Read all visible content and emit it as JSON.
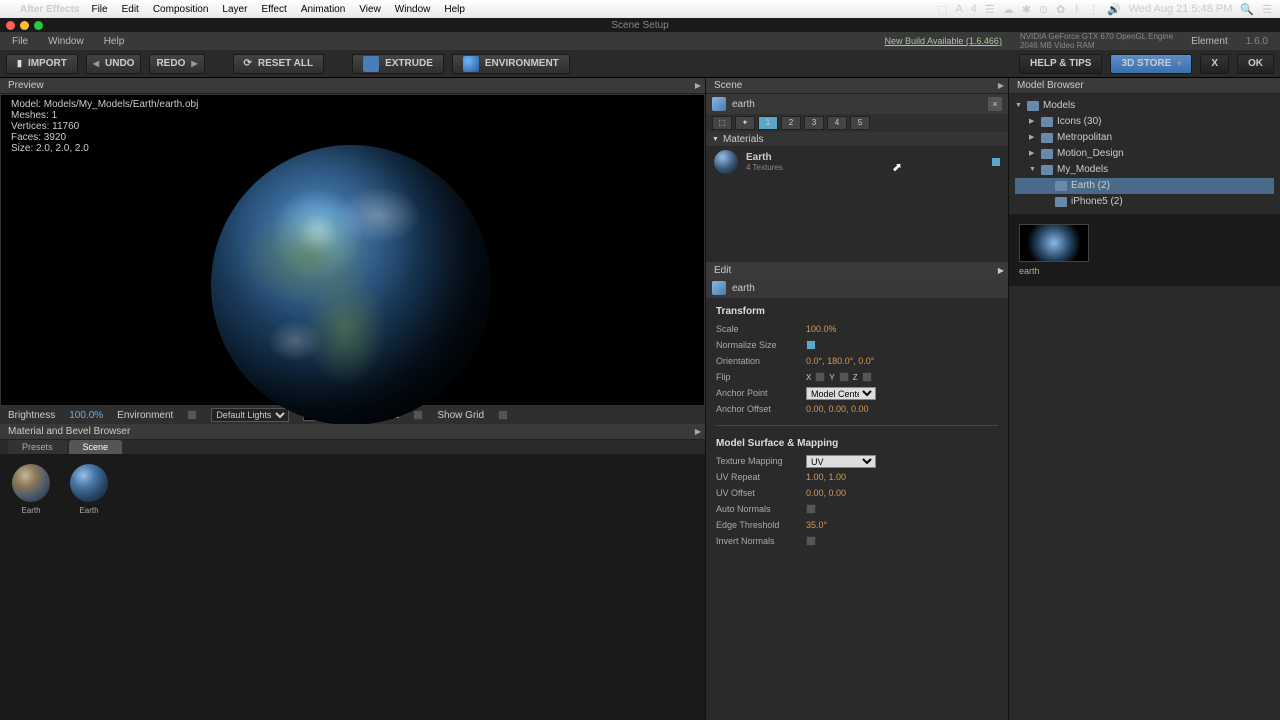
{
  "mac": {
    "app": "After Effects",
    "menus": [
      "File",
      "Edit",
      "Composition",
      "Layer",
      "Effect",
      "Animation",
      "View",
      "Window",
      "Help"
    ],
    "date": "Wed Aug 21  5:48 PM"
  },
  "window": {
    "title": "Scene Setup"
  },
  "submenu": {
    "items": [
      "File",
      "Window",
      "Help"
    ],
    "link": "New Build Available (1.6.466)",
    "gpu1": "NVIDIA GeForce GTX 670 OpenGL Engine",
    "gpu2": "2046 MB Video RAM",
    "plugin": "Element",
    "version": "1.6.0"
  },
  "toolbar": {
    "import": "IMPORT",
    "undo": "UNDO",
    "redo": "REDO",
    "reset": "RESET ALL",
    "extrude": "EXTRUDE",
    "environment": "ENVIRONMENT",
    "help": "HELP & TIPS",
    "store": "3D STORE",
    "close": "X",
    "ok": "OK"
  },
  "preview": {
    "title": "Preview",
    "info_model": "Model: Models/My_Models/Earth/earth.obj",
    "info_meshes": "Meshes: 1",
    "info_vertices": "Vertices: 11760",
    "info_faces": "Faces: 3920",
    "info_size": "Size: 2.0, 2.0, 2.0",
    "footer": {
      "brightness_lbl": "Brightness",
      "brightness_val": "100.0%",
      "env_lbl": "Environment",
      "lights": "Default Lights",
      "draft": "Draft Textures",
      "grid": "Show Grid"
    }
  },
  "matbrowser": {
    "title": "Material and Bevel Browser",
    "tab_presets": "Presets",
    "tab_scene": "Scene",
    "thumbs": [
      {
        "label": "Earth"
      },
      {
        "label": "Earth"
      }
    ]
  },
  "scene": {
    "title": "Scene",
    "obj_name": "earth",
    "groups": [
      "1",
      "2",
      "3",
      "4",
      "5"
    ],
    "materials_hdr": "Materials",
    "mat_name": "Earth",
    "mat_sub": "4 Textures"
  },
  "edit": {
    "title": "Edit",
    "obj_name": "earth",
    "transform_hdr": "Transform",
    "scale_lbl": "Scale",
    "scale_val": "100.0%",
    "normsize_lbl": "Normalize Size",
    "orient_lbl": "Orientation",
    "orient_val": "0.0°, 180.0°, 0.0°",
    "flip_lbl": "Flip",
    "anchor_lbl": "Anchor Point",
    "anchor_val": "Model Center",
    "anchoroff_lbl": "Anchor Offset",
    "anchoroff_val": "0.00, 0.00, 0.00",
    "surface_hdr": "Model Surface & Mapping",
    "texmap_lbl": "Texture Mapping",
    "texmap_val": "UV",
    "uvrep_lbl": "UV Repeat",
    "uvrep_val": "1.00, 1.00",
    "uvoff_lbl": "UV Offset",
    "uvoff_val": "0.00, 0.00",
    "autonorm_lbl": "Auto Normals",
    "edge_lbl": "Edge Threshold",
    "edge_val": "35.0°",
    "invnorm_lbl": "Invert Normals"
  },
  "browser": {
    "title": "Model Browser",
    "tree": [
      {
        "label": "Models",
        "lvl": 0,
        "open": true
      },
      {
        "label": "Icons (30)",
        "lvl": 1,
        "open": false
      },
      {
        "label": "Metropolitan",
        "lvl": 1,
        "open": false
      },
      {
        "label": "Motion_Design",
        "lvl": 1,
        "open": false
      },
      {
        "label": "My_Models",
        "lvl": 1,
        "open": true
      },
      {
        "label": "Earth (2)",
        "lvl": 2,
        "sel": true
      },
      {
        "label": "iPhone5 (2)",
        "lvl": 2
      }
    ],
    "thumb_label": "earth"
  }
}
